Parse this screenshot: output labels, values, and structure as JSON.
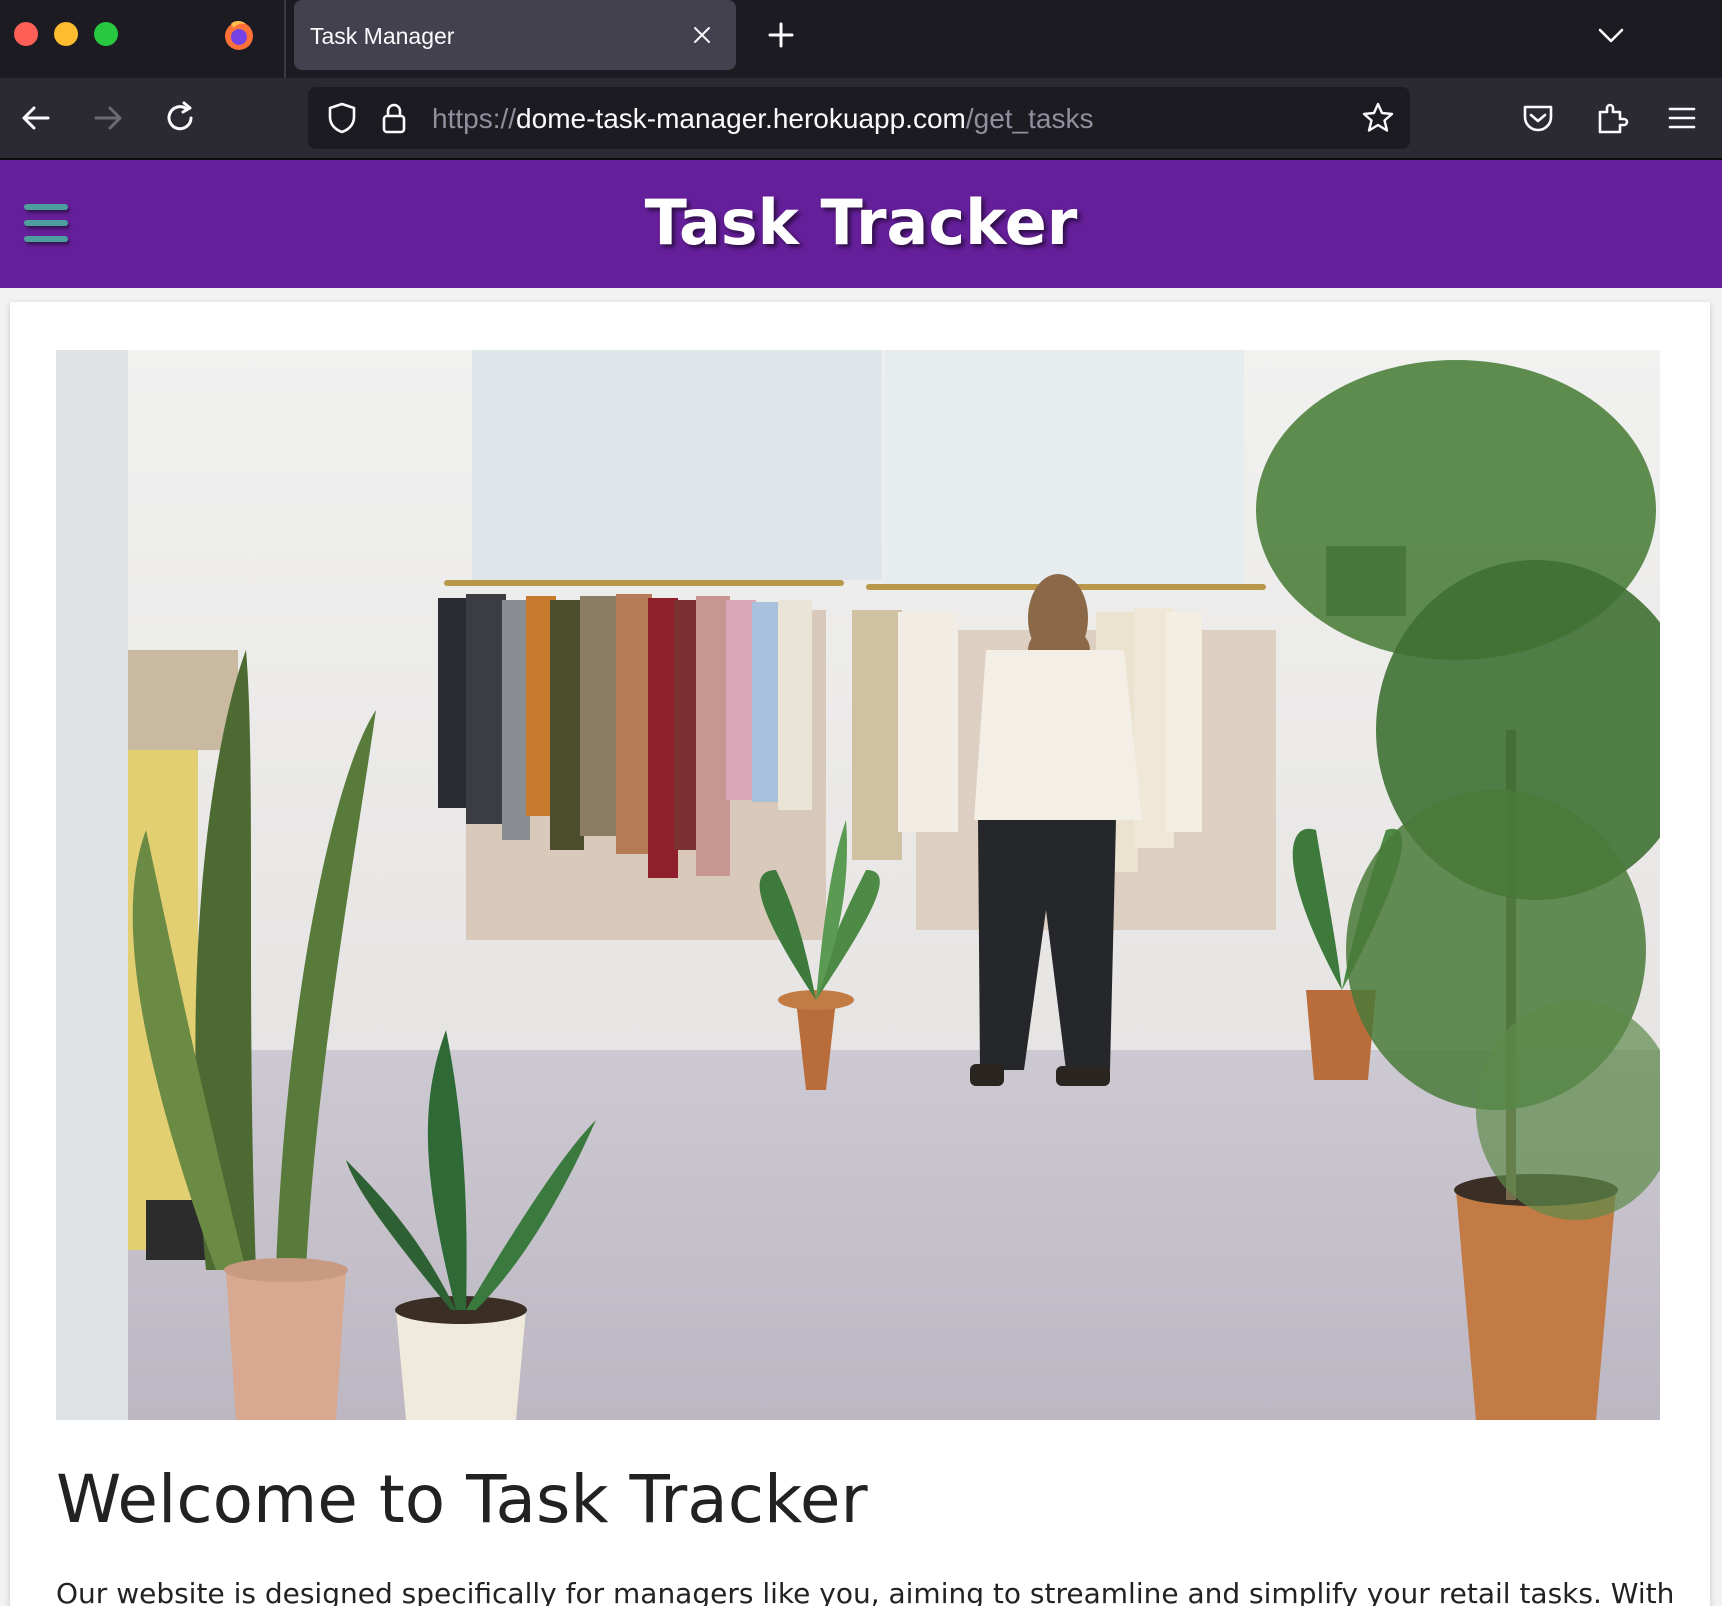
{
  "browser": {
    "tab_title": "Task Manager",
    "url": {
      "scheme": "https://",
      "host": "dome-task-manager.herokuapp.com",
      "path": "/get_tasks"
    },
    "icons": {
      "firefox": "firefox-logo-icon",
      "close_tab": "close-icon",
      "new_tab": "plus-icon",
      "tab_list": "chevron-down-icon",
      "back": "arrow-left-icon",
      "forward": "arrow-right-icon",
      "reload": "reload-icon",
      "tracking": "shield-icon",
      "lock": "lock-icon",
      "bookmark": "star-icon",
      "pocket": "pocket-icon",
      "extensions": "puzzle-icon",
      "menu": "hamburger-menu-icon"
    }
  },
  "site": {
    "title": "Task Tracker",
    "menu_icon": "hamburger-icon",
    "colors": {
      "header_bg": "#651f9a",
      "menu_icon": "#4d9f9d"
    }
  },
  "main": {
    "hero_image": "clothing-rack-photo",
    "heading": "Welcome to Task Tracker",
    "intro": "Our website is designed specifically for managers like you, aiming to streamline and simplify your retail tasks. With"
  }
}
